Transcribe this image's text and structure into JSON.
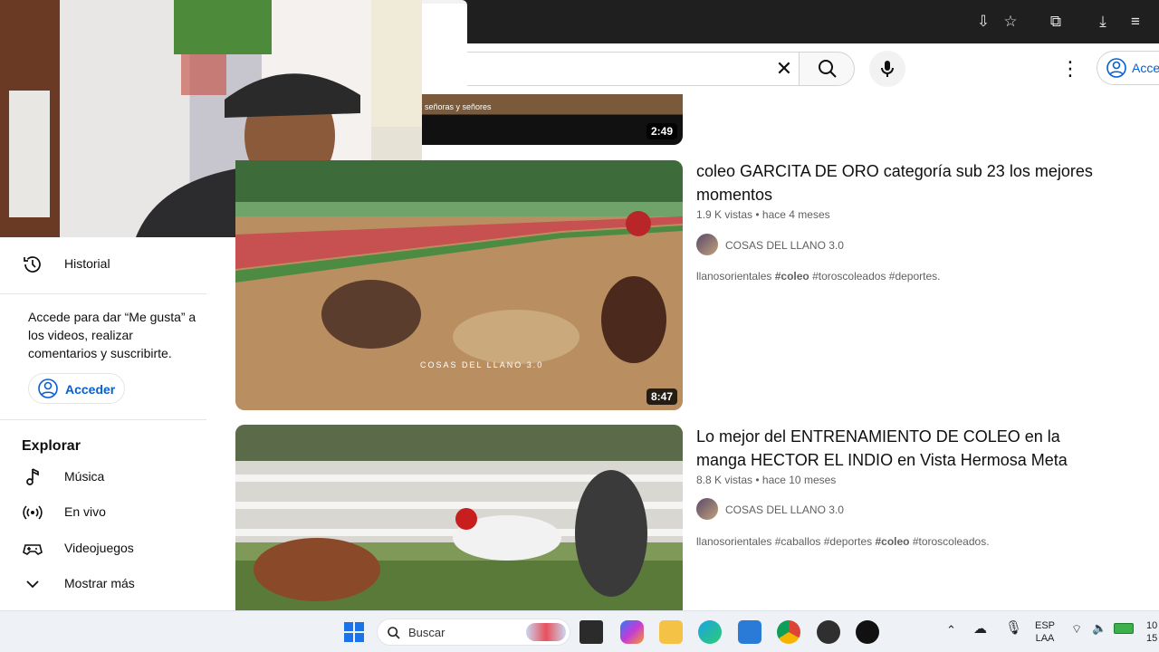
{
  "header": {
    "signin_label": "Acceder"
  },
  "previous_video": {
    "overlay_text": "señoras y señores",
    "duration": "2:49"
  },
  "sidebar": {
    "history_label": "Historial",
    "promo_text": "Accede para dar “Me gusta” a los videos, realizar comentarios y suscribirte.",
    "signin_label": "Acceder",
    "explore_title": "Explorar",
    "explore_items": [
      {
        "label": "Música",
        "icon": "music-note-icon"
      },
      {
        "label": "En vivo",
        "icon": "live-icon"
      },
      {
        "label": "Videojuegos",
        "icon": "gamepad-icon"
      },
      {
        "label": "Mostrar más",
        "icon": "chevron-down-icon"
      }
    ]
  },
  "videos": [
    {
      "title": "coleo GARCITA DE ORO categoría sub 23 los mejores momentos",
      "views": "1.9 K vistas",
      "age": "hace 4 meses",
      "channel": "COSAS DEL LLANO 3.0",
      "duration": "8:47",
      "watermark": "COSAS DEL LLANO 3.0",
      "desc": [
        "llanosorientales ",
        "#coleo",
        " #toroscoleados #deportes."
      ]
    },
    {
      "title": "Lo mejor del ENTRENAMIENTO DE COLEO en la manga HECTOR EL INDIO en Vista Hermosa Meta",
      "views": "8.8 K vistas",
      "age": "hace 10 meses",
      "channel": "COSAS DEL LLANO 3.0",
      "desc": [
        "llanosorientales #caballos #deportes ",
        "#coleo",
        " #toroscoleados."
      ]
    }
  ],
  "taskbar": {
    "search_label": "Buscar",
    "lang_top": "ESP",
    "lang_bottom": "LAA",
    "clock_top": "10",
    "clock_bottom": "15"
  },
  "colors": {
    "accent_blue": "#065fd4",
    "browser_bar": "#1f1f1f",
    "text_secondary": "#606060"
  }
}
